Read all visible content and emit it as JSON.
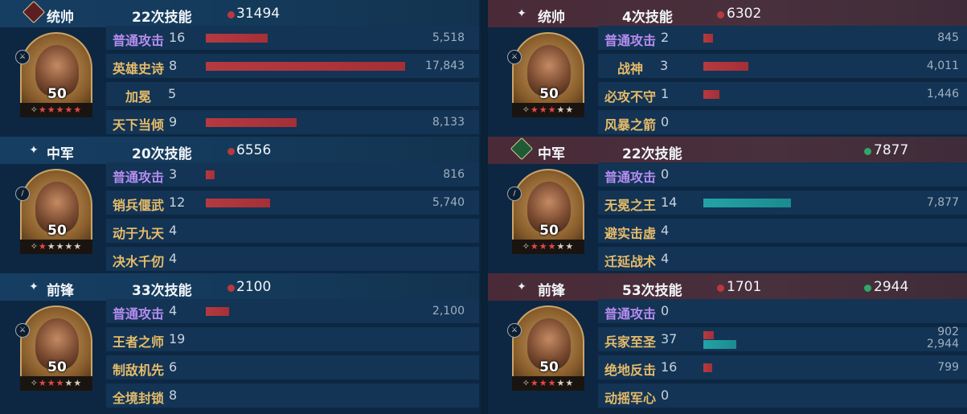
{
  "left": {
    "units": [
      {
        "role": "统帅",
        "skill_count": "22次技能",
        "damage": [
          {
            "value": "31494",
            "color": "red"
          }
        ],
        "level": "50",
        "stars": 5,
        "skills": [
          {
            "name": "普通攻击",
            "level": "16",
            "color": "purple",
            "bars": [
              {
                "value": 5518,
                "label": "5,518",
                "kind": "red"
              }
            ]
          },
          {
            "name": "英雄史诗",
            "level": "8",
            "color": "gold",
            "bars": [
              {
                "value": 17843,
                "label": "17,843",
                "kind": "red"
              }
            ]
          },
          {
            "name": "加冕",
            "level": "5",
            "color": "gold",
            "bars": []
          },
          {
            "name": "天下当倾",
            "level": "9",
            "color": "gold",
            "bars": [
              {
                "value": 8133,
                "label": "8,133",
                "kind": "red"
              }
            ]
          }
        ]
      },
      {
        "role": "中军",
        "skill_count": "20次技能",
        "damage": [
          {
            "value": "6556",
            "color": "red"
          }
        ],
        "level": "50",
        "stars": 1,
        "skills": [
          {
            "name": "普通攻击",
            "level": "3",
            "color": "purple",
            "bars": [
              {
                "value": 816,
                "label": "816",
                "kind": "red"
              }
            ]
          },
          {
            "name": "销兵偃武",
            "level": "12",
            "color": "gold",
            "bars": [
              {
                "value": 5740,
                "label": "5,740",
                "kind": "red"
              }
            ]
          },
          {
            "name": "动于九天",
            "level": "4",
            "color": "gold",
            "bars": []
          },
          {
            "name": "决水千仞",
            "level": "4",
            "color": "gold",
            "bars": []
          }
        ]
      },
      {
        "role": "前锋",
        "skill_count": "33次技能",
        "damage": [
          {
            "value": "2100",
            "color": "red"
          }
        ],
        "level": "50",
        "stars": 3,
        "skills": [
          {
            "name": "普通攻击",
            "level": "4",
            "color": "purple",
            "bars": [
              {
                "value": 2100,
                "label": "2,100",
                "kind": "red"
              }
            ]
          },
          {
            "name": "王者之师",
            "level": "19",
            "color": "gold",
            "bars": []
          },
          {
            "name": "制敌机先",
            "level": "6",
            "color": "gold",
            "bars": []
          },
          {
            "name": "全境封锁",
            "level": "8",
            "color": "gold",
            "bars": []
          }
        ]
      }
    ]
  },
  "right": {
    "units": [
      {
        "role": "统帅",
        "skill_count": "4次技能",
        "damage": [
          {
            "value": "6302",
            "color": "red"
          }
        ],
        "level": "50",
        "stars": 3,
        "skills": [
          {
            "name": "普通攻击",
            "level": "2",
            "color": "purple",
            "bars": [
              {
                "value": 845,
                "label": "845",
                "kind": "red"
              }
            ]
          },
          {
            "name": "战神",
            "level": "3",
            "color": "gold",
            "bars": [
              {
                "value": 4011,
                "label": "4,011",
                "kind": "red"
              }
            ]
          },
          {
            "name": "必攻不守",
            "level": "1",
            "color": "gold",
            "bars": [
              {
                "value": 1446,
                "label": "1,446",
                "kind": "red"
              }
            ]
          },
          {
            "name": "风暴之箭",
            "level": "0",
            "color": "gold",
            "bars": []
          }
        ]
      },
      {
        "role": "中军",
        "skill_count": "22次技能",
        "damage": [
          {
            "value": "7877",
            "color": "green"
          }
        ],
        "level": "50",
        "stars": 3,
        "skills": [
          {
            "name": "普通攻击",
            "level": "0",
            "color": "purple",
            "bars": []
          },
          {
            "name": "无冕之王",
            "level": "14",
            "color": "gold",
            "bars": [
              {
                "value": 7877,
                "label": "7,877",
                "kind": "teal"
              }
            ]
          },
          {
            "name": "避实击虚",
            "level": "4",
            "color": "gold",
            "bars": []
          },
          {
            "name": "迁延战术",
            "level": "4",
            "color": "gold",
            "bars": []
          }
        ]
      },
      {
        "role": "前锋",
        "skill_count": "53次技能",
        "damage": [
          {
            "value": "1701",
            "color": "red"
          },
          {
            "value": "2944",
            "color": "green"
          }
        ],
        "level": "50",
        "stars": 3,
        "skills": [
          {
            "name": "普通攻击",
            "level": "0",
            "color": "purple",
            "bars": []
          },
          {
            "name": "兵家至圣",
            "level": "37",
            "color": "gold",
            "bars": [
              {
                "value": 902,
                "label": "902",
                "kind": "red"
              },
              {
                "value": 2944,
                "label": "2,944",
                "kind": "teal"
              }
            ]
          },
          {
            "name": "绝地反击",
            "level": "16",
            "color": "gold",
            "bars": [
              {
                "value": 799,
                "label": "799",
                "kind": "red"
              }
            ]
          },
          {
            "name": "动摇军心",
            "level": "0",
            "color": "gold",
            "bars": []
          }
        ]
      }
    ]
  }
}
